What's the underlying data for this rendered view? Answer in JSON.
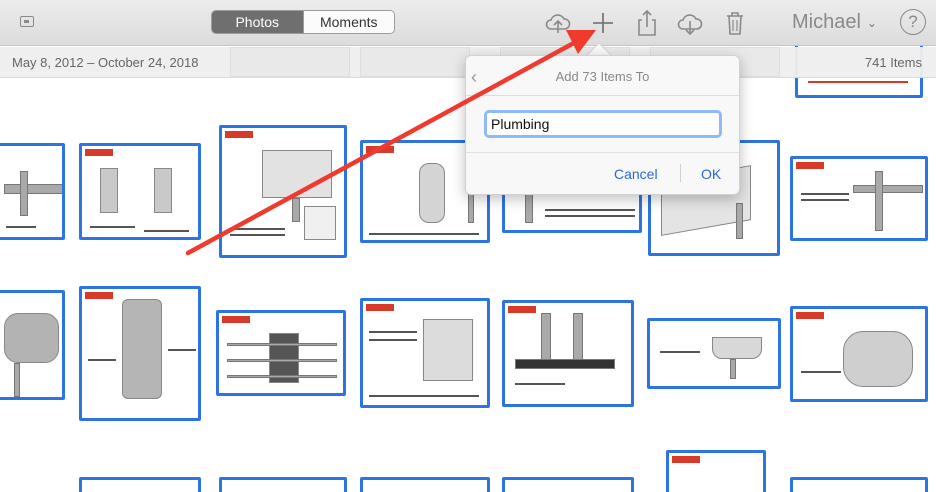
{
  "toolbar": {
    "tabs": [
      {
        "label": "Photos",
        "active": true
      },
      {
        "label": "Moments",
        "active": false
      }
    ],
    "user_name": "Michael",
    "help_label": "?"
  },
  "date_bar": {
    "range": "May 8, 2012 – October 24, 2018",
    "count": "741 Items"
  },
  "popover": {
    "title": "Add 73 Items To",
    "input_value": "Plumbing",
    "cancel_label": "Cancel",
    "ok_label": "OK"
  },
  "colors": {
    "selection": "#2d74e1",
    "annotation_arrow": "#f03a2e",
    "link": "#2a68d6",
    "active_tab": "#6f6f6f"
  },
  "icons": [
    "sidebar-icon",
    "cloud-upload-icon",
    "plus-icon",
    "share-icon",
    "cloud-download-icon",
    "trash-icon",
    "chevron-down-icon",
    "help-icon",
    "back-chevron-icon"
  ]
}
